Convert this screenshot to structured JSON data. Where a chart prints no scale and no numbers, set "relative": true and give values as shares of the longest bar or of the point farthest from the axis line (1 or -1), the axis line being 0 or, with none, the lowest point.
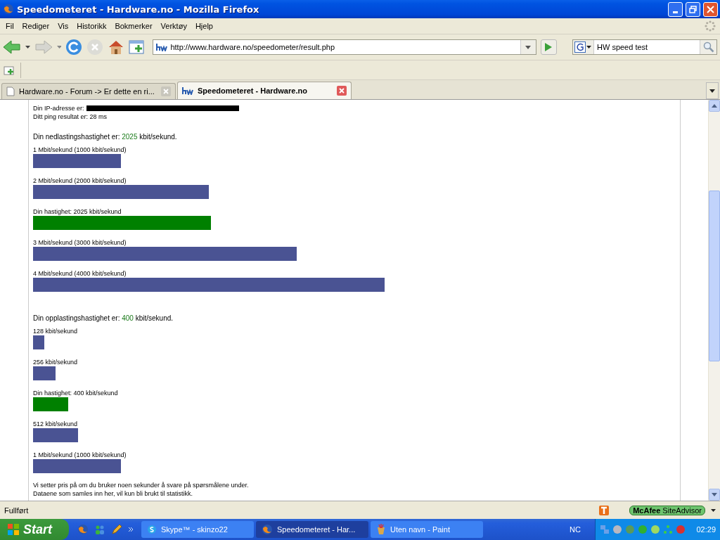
{
  "window": {
    "title": "Speedometeret - Hardware.no - Mozilla Firefox"
  },
  "menu": [
    "Fil",
    "Rediger",
    "Vis",
    "Historikk",
    "Bokmerker",
    "Verktøy",
    "Hjelp"
  ],
  "navigation": {
    "url": "http://www.hardware.no/speedometer/result.php",
    "search_value": "HW speed test"
  },
  "tabs": [
    {
      "label": "Hardware.no - Forum -> Er dette en ri...",
      "selected": false,
      "kind": "page"
    },
    {
      "label": "Speedometeret - Hardware.no",
      "selected": true,
      "kind": "site"
    }
  ],
  "page": {
    "ip_label": "Din IP-adresse er:",
    "ping": "Ditt ping resultat er: 28 ms",
    "sections": [
      {
        "label": "Din nedlastingshastighet er:",
        "value": "2025",
        "unit": "kbit/sekund.",
        "chart_data": {
          "type": "bar",
          "orientation": "horizontal",
          "relative": true,
          "categories": [
            "1 Mbit/sekund (1000 kbit/sekund)",
            "2 Mbit/sekund (2000 kbit/sekund)",
            "Din hastighet: 2025 kbit/sekund",
            "3 Mbit/sekund (3000 kbit/sekund)",
            "4 Mbit/sekund (4000 kbit/sekund)"
          ],
          "series": [
            {
              "color": "#4a5393",
              "values": [
                0.25,
                0.5,
                null,
                0.75,
                1
              ]
            },
            {
              "color": "#008000",
              "values": [
                null,
                null,
                0.506,
                null,
                null
              ]
            }
          ]
        }
      },
      {
        "label": "Din opplastingshastighet er:",
        "value": "400",
        "unit": "kbit/sekund.",
        "chart_data": {
          "type": "bar",
          "orientation": "horizontal",
          "relative": true,
          "categories": [
            "128 kbit/sekund",
            "256 kbit/sekund",
            "Din hastighet: 400 kbit/sekund",
            "512 kbit/sekund",
            "1 Mbit/sekund (1000 kbit/sekund)"
          ],
          "series": [
            {
              "color": "#4a5393",
              "values": [
                0.128,
                0.256,
                null,
                0.512,
                1
              ]
            },
            {
              "color": "#008000",
              "values": [
                null,
                null,
                0.4,
                null,
                null
              ]
            }
          ]
        }
      }
    ],
    "footer": [
      "Vi setter pris på om du bruker noen sekunder å svare på spørsmålene under.",
      "Dataene som samles inn her, vil kun bli brukt til statistikk."
    ]
  },
  "status_bar": {
    "text": "Fullført",
    "siteadvisor_brand": "McAfee",
    "siteadvisor_product": "SiteAdvisor"
  },
  "taskbar": {
    "start": "Start",
    "tasks": [
      {
        "label": "Skype™ - skinzo22",
        "kind": "skype",
        "selected": false
      },
      {
        "label": "Speedometeret - Har...",
        "kind": "browser",
        "selected": true
      },
      {
        "label": "Uten navn - Paint",
        "kind": "paint",
        "selected": false
      }
    ],
    "language": "NC",
    "clock": "02:29"
  }
}
